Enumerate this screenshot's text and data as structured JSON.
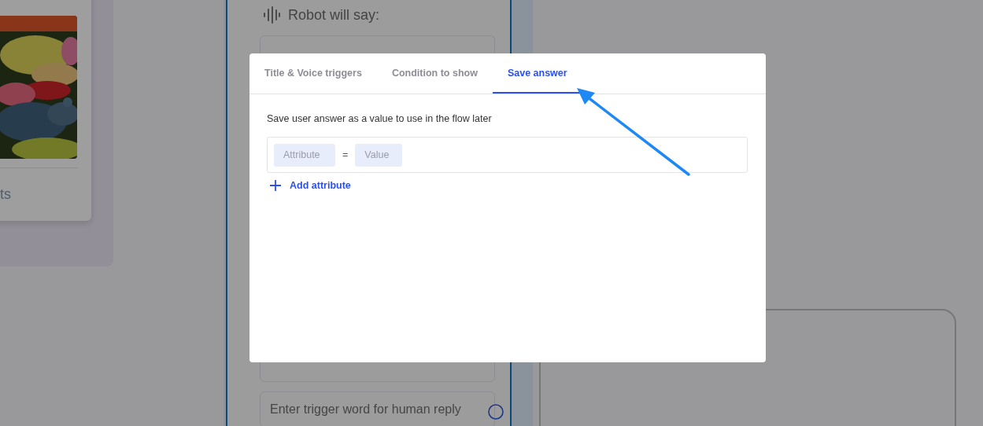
{
  "canvas": {
    "image_card": {
      "caption": "ts"
    },
    "robot_node": {
      "heading": "Robot will say:",
      "reply_fields": [
        {
          "placeholder": "Enter trigger word for human reply"
        }
      ]
    }
  },
  "modal": {
    "tabs": [
      {
        "label": "Title & Voice triggers",
        "selected": false
      },
      {
        "label": "Condition to show",
        "selected": false
      },
      {
        "label": "Save answer",
        "selected": true
      }
    ],
    "description": "Save user answer as a value to use in the flow later",
    "attribute_row": {
      "attribute_placeholder": "Attribute",
      "operator": "=",
      "value_placeholder": "Value"
    },
    "add_button": "Add attribute"
  }
}
